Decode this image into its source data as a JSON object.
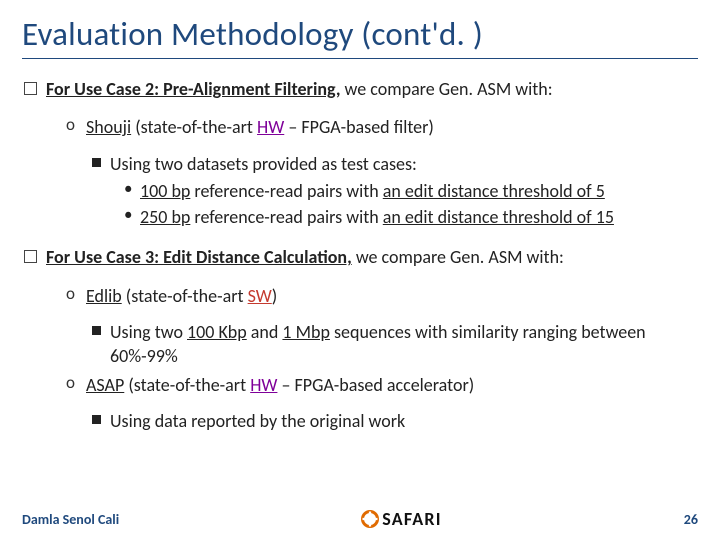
{
  "title": "Evaluation Methodology (cont'd. )",
  "uc2": {
    "lead_bold": "For Use Case 2: Pre-Alignment Filtering,",
    "lead_rest": " we compare Gen. ASM with:",
    "item": {
      "name": "Shouji",
      "desc1": " (state-of-the-art ",
      "hw": "HW",
      "desc2": " – FPGA-based filter)",
      "sub": "Using two datasets provided as test cases:",
      "d1a": "100 bp",
      "d1b": " reference-read pairs with ",
      "d1c": "an edit distance threshold of 5",
      "d2a": "250 bp",
      "d2b": " reference-read pairs with ",
      "d2c": "an edit distance threshold of 15"
    }
  },
  "uc3": {
    "lead_bold": "For Use Case 3: Edit Distance Calculation,",
    "lead_rest": " we compare Gen. ASM with:",
    "item1": {
      "name": "Edlib",
      "desc1": " (state-of-the-art ",
      "sw": "SW",
      "desc2": ")",
      "sub1": "Using two ",
      "sub2": "100 Kbp",
      "sub3": " and ",
      "sub4": "1 Mbp",
      "sub5": " sequences with similarity ranging between 60%-99%"
    },
    "item2": {
      "name": "ASAP",
      "desc1": " (state-of-the-art ",
      "hw": "HW",
      "desc2": " – FPGA-based accelerator)",
      "sub": "Using data reported by the original work"
    }
  },
  "footer": {
    "author": "Damla Senol Cali",
    "logo": "SAFARI",
    "page": "26"
  }
}
